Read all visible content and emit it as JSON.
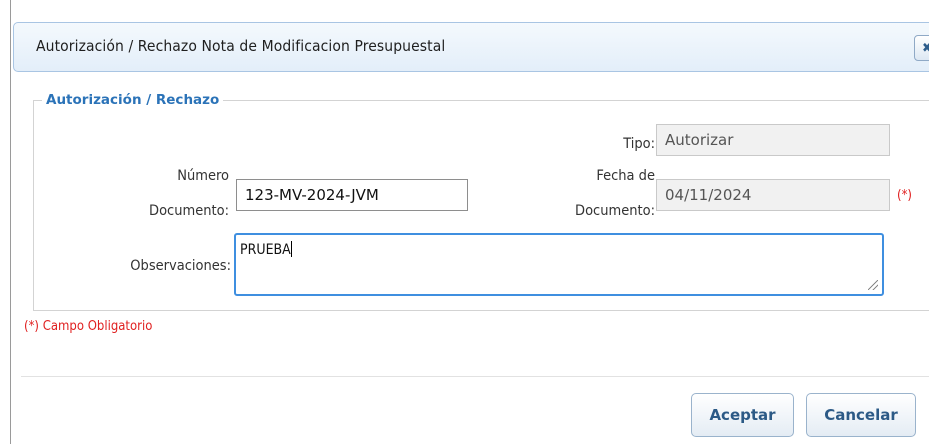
{
  "dialog": {
    "title": "Autorización / Rechazo Nota de Modificacion Presupuestal",
    "close_glyph": "✖"
  },
  "group": {
    "legend": "Autorización / Rechazo"
  },
  "form": {
    "tipo_label": "Tipo:",
    "tipo_value": "Autorizar",
    "numero_label_line1": "Número",
    "numero_label_line2": "Documento:",
    "numero_value": "123-MV-2024-JVM",
    "fecha_label_line1": "Fecha de",
    "fecha_label_line2": "Documento:",
    "fecha_value": "04/11/2024",
    "fecha_required": "(*)",
    "observaciones_label": "Observaciones:",
    "observaciones_value": "PRUEBA"
  },
  "footer": {
    "required_note": "(*) Campo Obligatorio",
    "accept_label": "Aceptar",
    "cancel_label": "Cancelar"
  },
  "colors": {
    "accent": "#2b73b8",
    "required": "#e02020",
    "focus_border": "#3f8fe0"
  }
}
